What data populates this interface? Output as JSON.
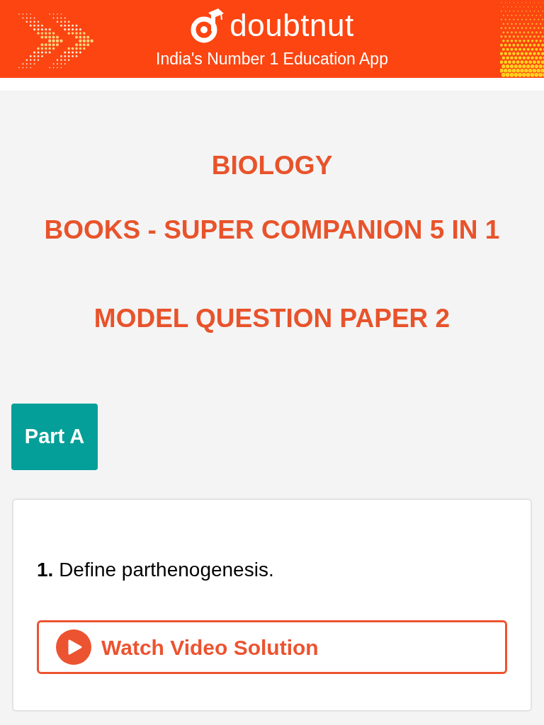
{
  "header": {
    "brand": "doubtnut",
    "tagline": "India's Number 1 Education App"
  },
  "titles": [
    "BIOLOGY",
    "BOOKS - SUPER COMPANION 5 IN 1",
    "MODEL QUESTION PAPER 2"
  ],
  "section": {
    "label": "Part A"
  },
  "questions": [
    {
      "text": "**1.** Define parthenogenesis.",
      "button": "Watch Video Solution"
    }
  ]
}
